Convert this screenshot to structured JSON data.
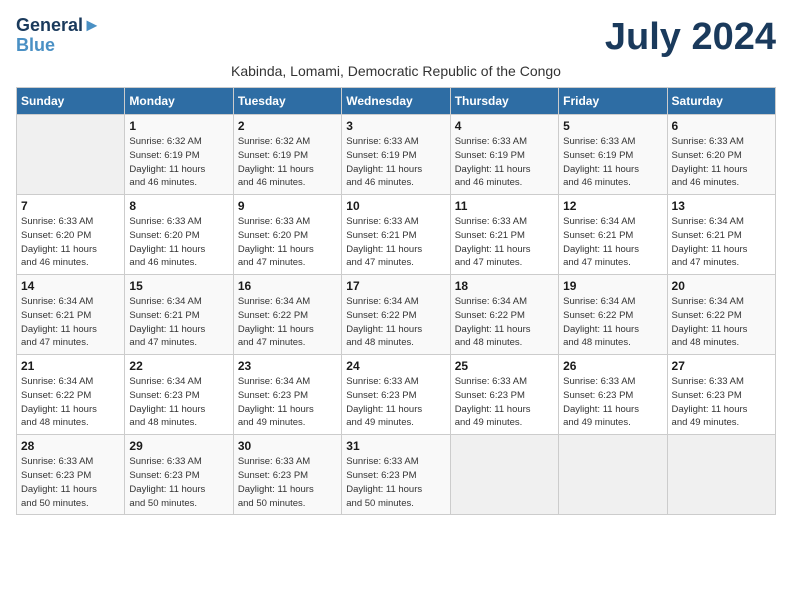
{
  "logo": {
    "line1": "General",
    "line2": "Blue"
  },
  "title": "July 2024",
  "subtitle": "Kabinda, Lomami, Democratic Republic of the Congo",
  "days_of_week": [
    "Sunday",
    "Monday",
    "Tuesday",
    "Wednesday",
    "Thursday",
    "Friday",
    "Saturday"
  ],
  "weeks": [
    [
      {
        "day": "",
        "info": ""
      },
      {
        "day": "1",
        "info": "Sunrise: 6:32 AM\nSunset: 6:19 PM\nDaylight: 11 hours\nand 46 minutes."
      },
      {
        "day": "2",
        "info": "Sunrise: 6:32 AM\nSunset: 6:19 PM\nDaylight: 11 hours\nand 46 minutes."
      },
      {
        "day": "3",
        "info": "Sunrise: 6:33 AM\nSunset: 6:19 PM\nDaylight: 11 hours\nand 46 minutes."
      },
      {
        "day": "4",
        "info": "Sunrise: 6:33 AM\nSunset: 6:19 PM\nDaylight: 11 hours\nand 46 minutes."
      },
      {
        "day": "5",
        "info": "Sunrise: 6:33 AM\nSunset: 6:19 PM\nDaylight: 11 hours\nand 46 minutes."
      },
      {
        "day": "6",
        "info": "Sunrise: 6:33 AM\nSunset: 6:20 PM\nDaylight: 11 hours\nand 46 minutes."
      }
    ],
    [
      {
        "day": "7",
        "info": "Sunrise: 6:33 AM\nSunset: 6:20 PM\nDaylight: 11 hours\nand 46 minutes."
      },
      {
        "day": "8",
        "info": "Sunrise: 6:33 AM\nSunset: 6:20 PM\nDaylight: 11 hours\nand 46 minutes."
      },
      {
        "day": "9",
        "info": "Sunrise: 6:33 AM\nSunset: 6:20 PM\nDaylight: 11 hours\nand 47 minutes."
      },
      {
        "day": "10",
        "info": "Sunrise: 6:33 AM\nSunset: 6:21 PM\nDaylight: 11 hours\nand 47 minutes."
      },
      {
        "day": "11",
        "info": "Sunrise: 6:33 AM\nSunset: 6:21 PM\nDaylight: 11 hours\nand 47 minutes."
      },
      {
        "day": "12",
        "info": "Sunrise: 6:34 AM\nSunset: 6:21 PM\nDaylight: 11 hours\nand 47 minutes."
      },
      {
        "day": "13",
        "info": "Sunrise: 6:34 AM\nSunset: 6:21 PM\nDaylight: 11 hours\nand 47 minutes."
      }
    ],
    [
      {
        "day": "14",
        "info": "Sunrise: 6:34 AM\nSunset: 6:21 PM\nDaylight: 11 hours\nand 47 minutes."
      },
      {
        "day": "15",
        "info": "Sunrise: 6:34 AM\nSunset: 6:21 PM\nDaylight: 11 hours\nand 47 minutes."
      },
      {
        "day": "16",
        "info": "Sunrise: 6:34 AM\nSunset: 6:22 PM\nDaylight: 11 hours\nand 47 minutes."
      },
      {
        "day": "17",
        "info": "Sunrise: 6:34 AM\nSunset: 6:22 PM\nDaylight: 11 hours\nand 48 minutes."
      },
      {
        "day": "18",
        "info": "Sunrise: 6:34 AM\nSunset: 6:22 PM\nDaylight: 11 hours\nand 48 minutes."
      },
      {
        "day": "19",
        "info": "Sunrise: 6:34 AM\nSunset: 6:22 PM\nDaylight: 11 hours\nand 48 minutes."
      },
      {
        "day": "20",
        "info": "Sunrise: 6:34 AM\nSunset: 6:22 PM\nDaylight: 11 hours\nand 48 minutes."
      }
    ],
    [
      {
        "day": "21",
        "info": "Sunrise: 6:34 AM\nSunset: 6:22 PM\nDaylight: 11 hours\nand 48 minutes."
      },
      {
        "day": "22",
        "info": "Sunrise: 6:34 AM\nSunset: 6:23 PM\nDaylight: 11 hours\nand 48 minutes."
      },
      {
        "day": "23",
        "info": "Sunrise: 6:34 AM\nSunset: 6:23 PM\nDaylight: 11 hours\nand 49 minutes."
      },
      {
        "day": "24",
        "info": "Sunrise: 6:33 AM\nSunset: 6:23 PM\nDaylight: 11 hours\nand 49 minutes."
      },
      {
        "day": "25",
        "info": "Sunrise: 6:33 AM\nSunset: 6:23 PM\nDaylight: 11 hours\nand 49 minutes."
      },
      {
        "day": "26",
        "info": "Sunrise: 6:33 AM\nSunset: 6:23 PM\nDaylight: 11 hours\nand 49 minutes."
      },
      {
        "day": "27",
        "info": "Sunrise: 6:33 AM\nSunset: 6:23 PM\nDaylight: 11 hours\nand 49 minutes."
      }
    ],
    [
      {
        "day": "28",
        "info": "Sunrise: 6:33 AM\nSunset: 6:23 PM\nDaylight: 11 hours\nand 50 minutes."
      },
      {
        "day": "29",
        "info": "Sunrise: 6:33 AM\nSunset: 6:23 PM\nDaylight: 11 hours\nand 50 minutes."
      },
      {
        "day": "30",
        "info": "Sunrise: 6:33 AM\nSunset: 6:23 PM\nDaylight: 11 hours\nand 50 minutes."
      },
      {
        "day": "31",
        "info": "Sunrise: 6:33 AM\nSunset: 6:23 PM\nDaylight: 11 hours\nand 50 minutes."
      },
      {
        "day": "",
        "info": ""
      },
      {
        "day": "",
        "info": ""
      },
      {
        "day": "",
        "info": ""
      }
    ]
  ]
}
